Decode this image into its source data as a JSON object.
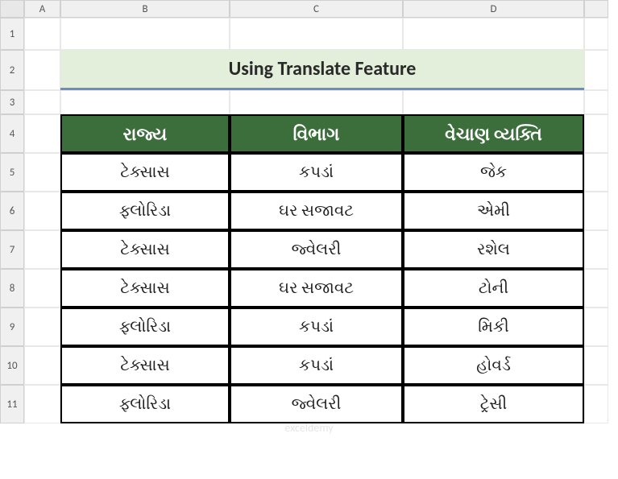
{
  "columns": [
    "A",
    "B",
    "C",
    "D",
    ""
  ],
  "rows": [
    "1",
    "2",
    "3",
    "4",
    "5",
    "6",
    "7",
    "8",
    "9",
    "10",
    "11"
  ],
  "title": "Using Translate Feature",
  "headers": [
    "રાજ્ય",
    "વિભાગ",
    "વેચાણ વ્યક્તિ"
  ],
  "chart_data": {
    "type": "table",
    "columns": [
      "રાજ્ય",
      "વિભાગ",
      "વેચાણ વ્યક્તિ"
    ],
    "rows": [
      [
        "ટેક્સાસ",
        "કપડાં",
        "જેક"
      ],
      [
        "ફ્લોરિડા",
        "ઘર સજાવટ",
        "એમી"
      ],
      [
        "ટેક્સાસ",
        "જ્વેલરી",
        "રશેલ"
      ],
      [
        "ટેક્સાસ",
        "ઘર સજાવટ",
        "ટોની"
      ],
      [
        "ફ્લોરિડા",
        "કપડાં",
        "મિકી"
      ],
      [
        "ટેક્સાસ",
        "કપડાં",
        "હોવર્ડ"
      ],
      [
        "ફ્લોરિડા",
        "જ્વેલરી",
        "ટ્રેસી"
      ]
    ]
  },
  "watermark": "exceldemy"
}
